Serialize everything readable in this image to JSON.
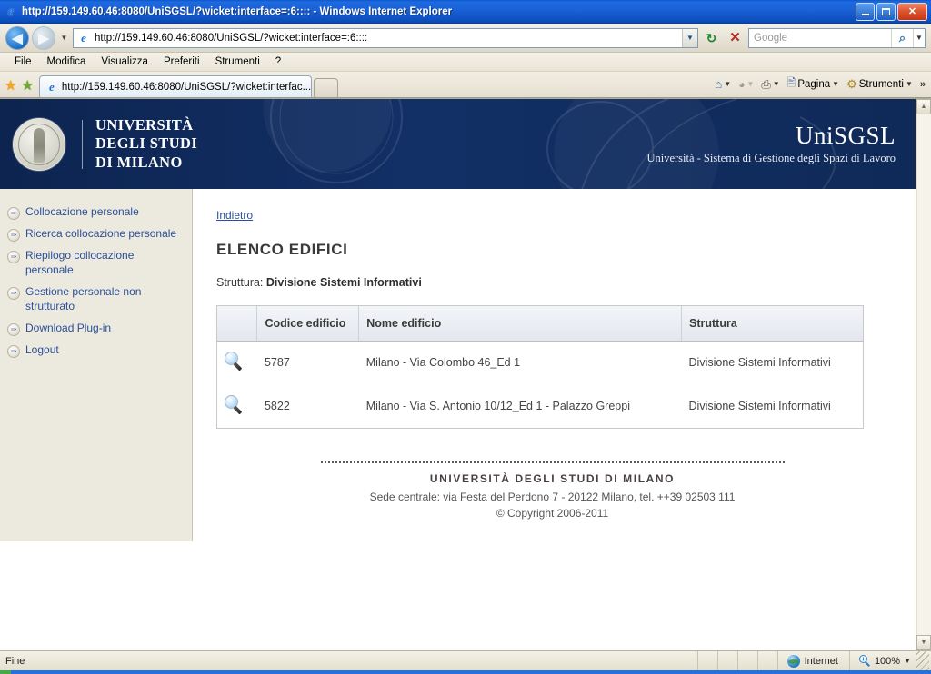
{
  "browser": {
    "title": "http://159.149.60.46:8080/UniSGSL/?wicket:interface=:6:::: - Windows Internet Explorer",
    "title_icon": "ie-logo-icon",
    "minimize_label": "Minimize",
    "restore_label": "Restore",
    "close_label": "✕",
    "address": {
      "url": "http://159.149.60.46:8080/UniSGSL/?wicket:interface=:6::::",
      "dropdown_glyph": "▼",
      "refresh_glyph": "↻",
      "stop_glyph": "✕"
    },
    "search": {
      "placeholder": "Google",
      "go_glyph": "⌕",
      "caret_glyph": "▼"
    },
    "nav": {
      "back_glyph": "◀",
      "forward_glyph": "▶",
      "history_caret": "▼"
    },
    "menu": [
      {
        "label": "File"
      },
      {
        "label": "Modifica"
      },
      {
        "label": "Visualizza"
      },
      {
        "label": "Preferiti"
      },
      {
        "label": "Strumenti"
      },
      {
        "label": "?"
      }
    ],
    "tabs": [
      {
        "label": "http://159.149.60.46:8080/UniSGSL/?wicket:interfac..."
      }
    ],
    "command_bar": [
      {
        "label": "",
        "icon": "home-icon",
        "caret": "▼"
      },
      {
        "label": "",
        "icon": "feeds-icon",
        "caret": "▼"
      },
      {
        "label": "",
        "icon": "print-icon",
        "caret": "▼"
      },
      {
        "label": "Pagina",
        "icon": "page-icon",
        "caret": "▼"
      },
      {
        "label": "Strumenti",
        "icon": "gear-icon",
        "caret": "▼"
      }
    ],
    "command_overflow": "»",
    "status": {
      "text": "Fine",
      "zone": "Internet",
      "zoom": "100%",
      "zoom_caret": "▼"
    },
    "scrollbar": {
      "up_glyph": "▲",
      "down_glyph": "▼"
    }
  },
  "site": {
    "header": {
      "university_line1": "UNIVERSITÀ",
      "university_line2": "DEGLI STUDI",
      "university_line3": "DI MILANO",
      "brand": "UniSGSL",
      "brand_subtitle": "Università - Sistema di Gestione degli Spazi di Lavoro",
      "seal_alt": "university-seal"
    },
    "sidebar": {
      "items": [
        {
          "label": "Collocazione personale",
          "bullet": "⇒"
        },
        {
          "label": "Ricerca collocazione personale",
          "bullet": "⇒"
        },
        {
          "label": "Riepilogo collocazione personale",
          "bullet": "⇒"
        },
        {
          "label": "Gestione personale non strutturato",
          "bullet": "⇒"
        },
        {
          "label": "Download Plug-in",
          "bullet": "⇒"
        },
        {
          "label": "Logout",
          "bullet": "⇒"
        }
      ]
    },
    "main": {
      "back_link": "Indietro",
      "page_title": "ELENCO EDIFICI",
      "structure_label": "Struttura:",
      "structure_value": "Divisione Sistemi Informativi",
      "table": {
        "columns": [
          "",
          "Codice edificio",
          "Nome edificio",
          "Struttura"
        ],
        "rows": [
          {
            "action_icon": "magnifier-icon",
            "codice": "5787",
            "nome": "Milano - Via Colombo 46_Ed 1",
            "struttura": "Divisione Sistemi Informativi"
          },
          {
            "action_icon": "magnifier-icon",
            "codice": "5822",
            "nome": "Milano - Via S. Antonio 10/12_Ed 1 - Palazzo Greppi",
            "struttura": "Divisione Sistemi Informativi"
          }
        ]
      }
    },
    "footer": {
      "university": "UNIVERSITÀ DEGLI STUDI DI MILANO",
      "address": "Sede centrale: via Festa del Perdono 7 - 20122 Milano, tel. ++39 02503 111",
      "copyright": "© Copyright 2006-2011"
    }
  },
  "colors": {
    "header_blue": "#102b5c",
    "link_blue": "#2b4f9c",
    "sidebar_bg": "#eceade",
    "title_bar_blue": "#1c62d8"
  }
}
